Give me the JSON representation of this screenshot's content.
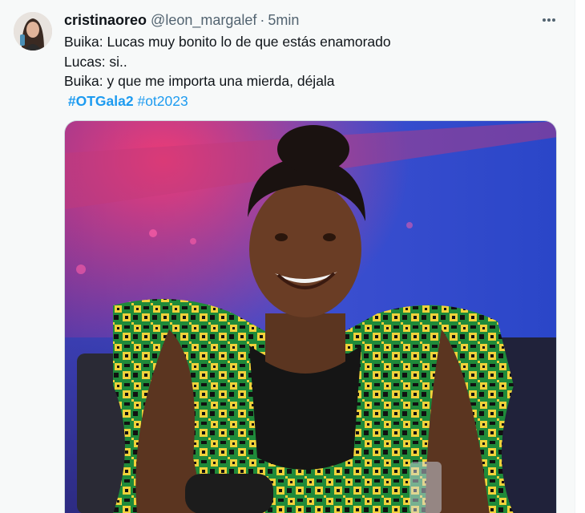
{
  "tweet": {
    "display_name": "cristinaoreo",
    "handle": "@leon_margalef",
    "separator": "·",
    "time": "5min",
    "more_icon": "more-horizontal-icon",
    "lines": [
      "Buika: Lucas muy bonito lo de que estás enamorado",
      "Lucas: si..",
      "Buika: y que me importa una mierda, déjala"
    ],
    "hashtags": [
      "#OTGala2",
      "#ot2023"
    ],
    "media_alt": "photo",
    "colors": {
      "hashtag": "#1d9bf0",
      "secondary_text": "#536471",
      "background": "#f7f9f9"
    }
  }
}
